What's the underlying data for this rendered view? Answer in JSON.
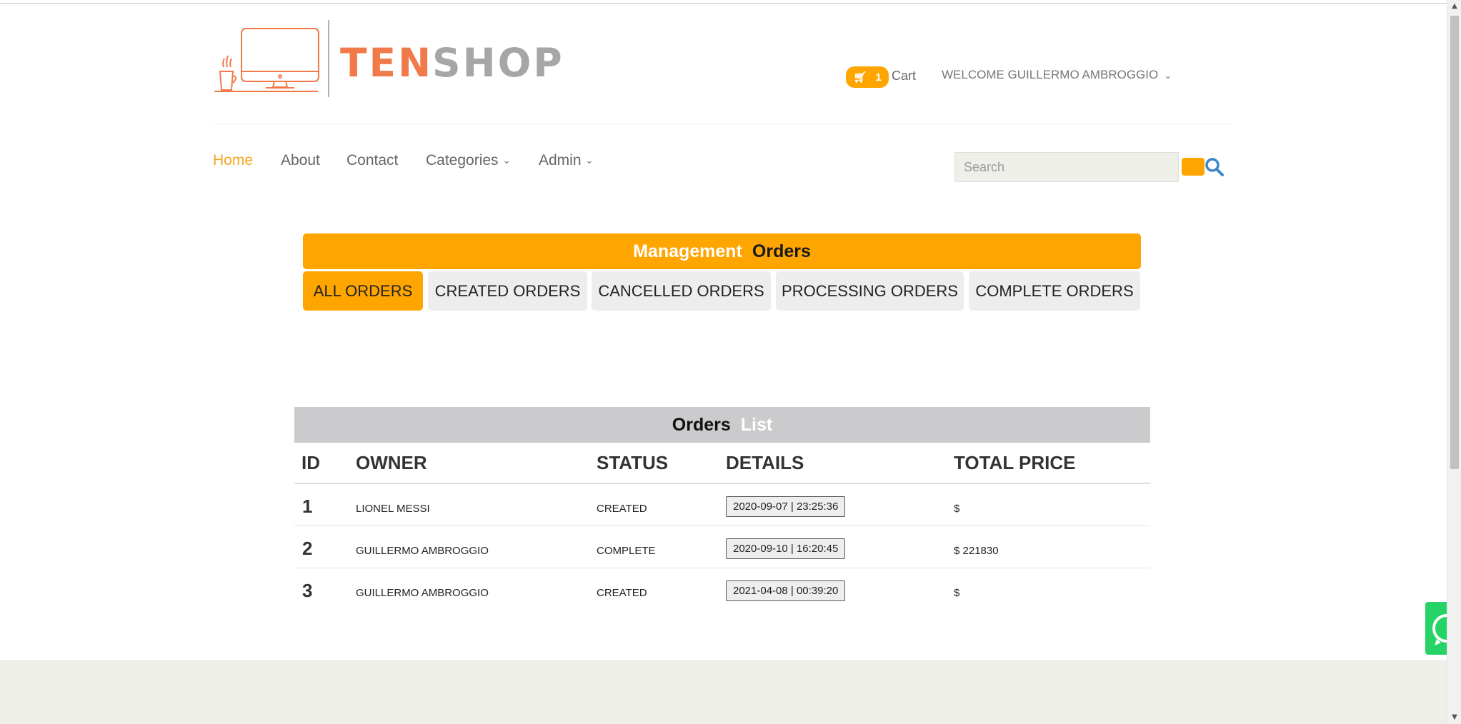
{
  "brand": {
    "word1": "TEN",
    "word2": "SHOP"
  },
  "header": {
    "cart_count": "1",
    "cart_label": "Cart",
    "welcome": "WELCOME GUILLERMO AMBROGGIO"
  },
  "nav": {
    "home": "Home",
    "about": "About",
    "contact": "Contact",
    "categories": "Categories",
    "admin": "Admin"
  },
  "search": {
    "placeholder": "Search"
  },
  "management": {
    "title_word1": "Management",
    "title_word2": "Orders",
    "tabs": [
      "ALL ORDERS",
      "CREATED ORDERS",
      "CANCELLED ORDERS",
      "PROCESSING ORDERS",
      "COMPLETE ORDERS"
    ],
    "active_tab": "ALL ORDERS"
  },
  "orders": {
    "title_word1": "Orders",
    "title_word2": "List",
    "columns": [
      "ID",
      "OWNER",
      "STATUS",
      "DETAILS",
      "TOTAL PRICE"
    ],
    "rows": [
      {
        "id": "1",
        "owner": "LIONEL MESSI",
        "status": "CREATED",
        "details": "2020-09-07 | 23:25:36",
        "price": "$"
      },
      {
        "id": "2",
        "owner": "GUILLERMO AMBROGGIO",
        "status": "COMPLETE",
        "details": "2020-09-10 | 16:20:45",
        "price": "$ 221830"
      },
      {
        "id": "3",
        "owner": "GUILLERMO AMBROGGIO",
        "status": "CREATED",
        "details": "2021-04-08 | 00:39:20",
        "price": "$"
      }
    ]
  },
  "colors": {
    "accent": "#ffa500",
    "logo_orange": "#f07a4a",
    "logo_gray": "#a6a6a6",
    "list_header": "#cbcacc",
    "footer": "#efefe9",
    "whatsapp": "#25d366",
    "search_icon": "#3a87c9"
  },
  "icons": {
    "cart": "cart-icon",
    "search": "search-icon",
    "whatsapp": "whatsapp-icon",
    "logo": "desktop-monitor-coffee-icon"
  }
}
